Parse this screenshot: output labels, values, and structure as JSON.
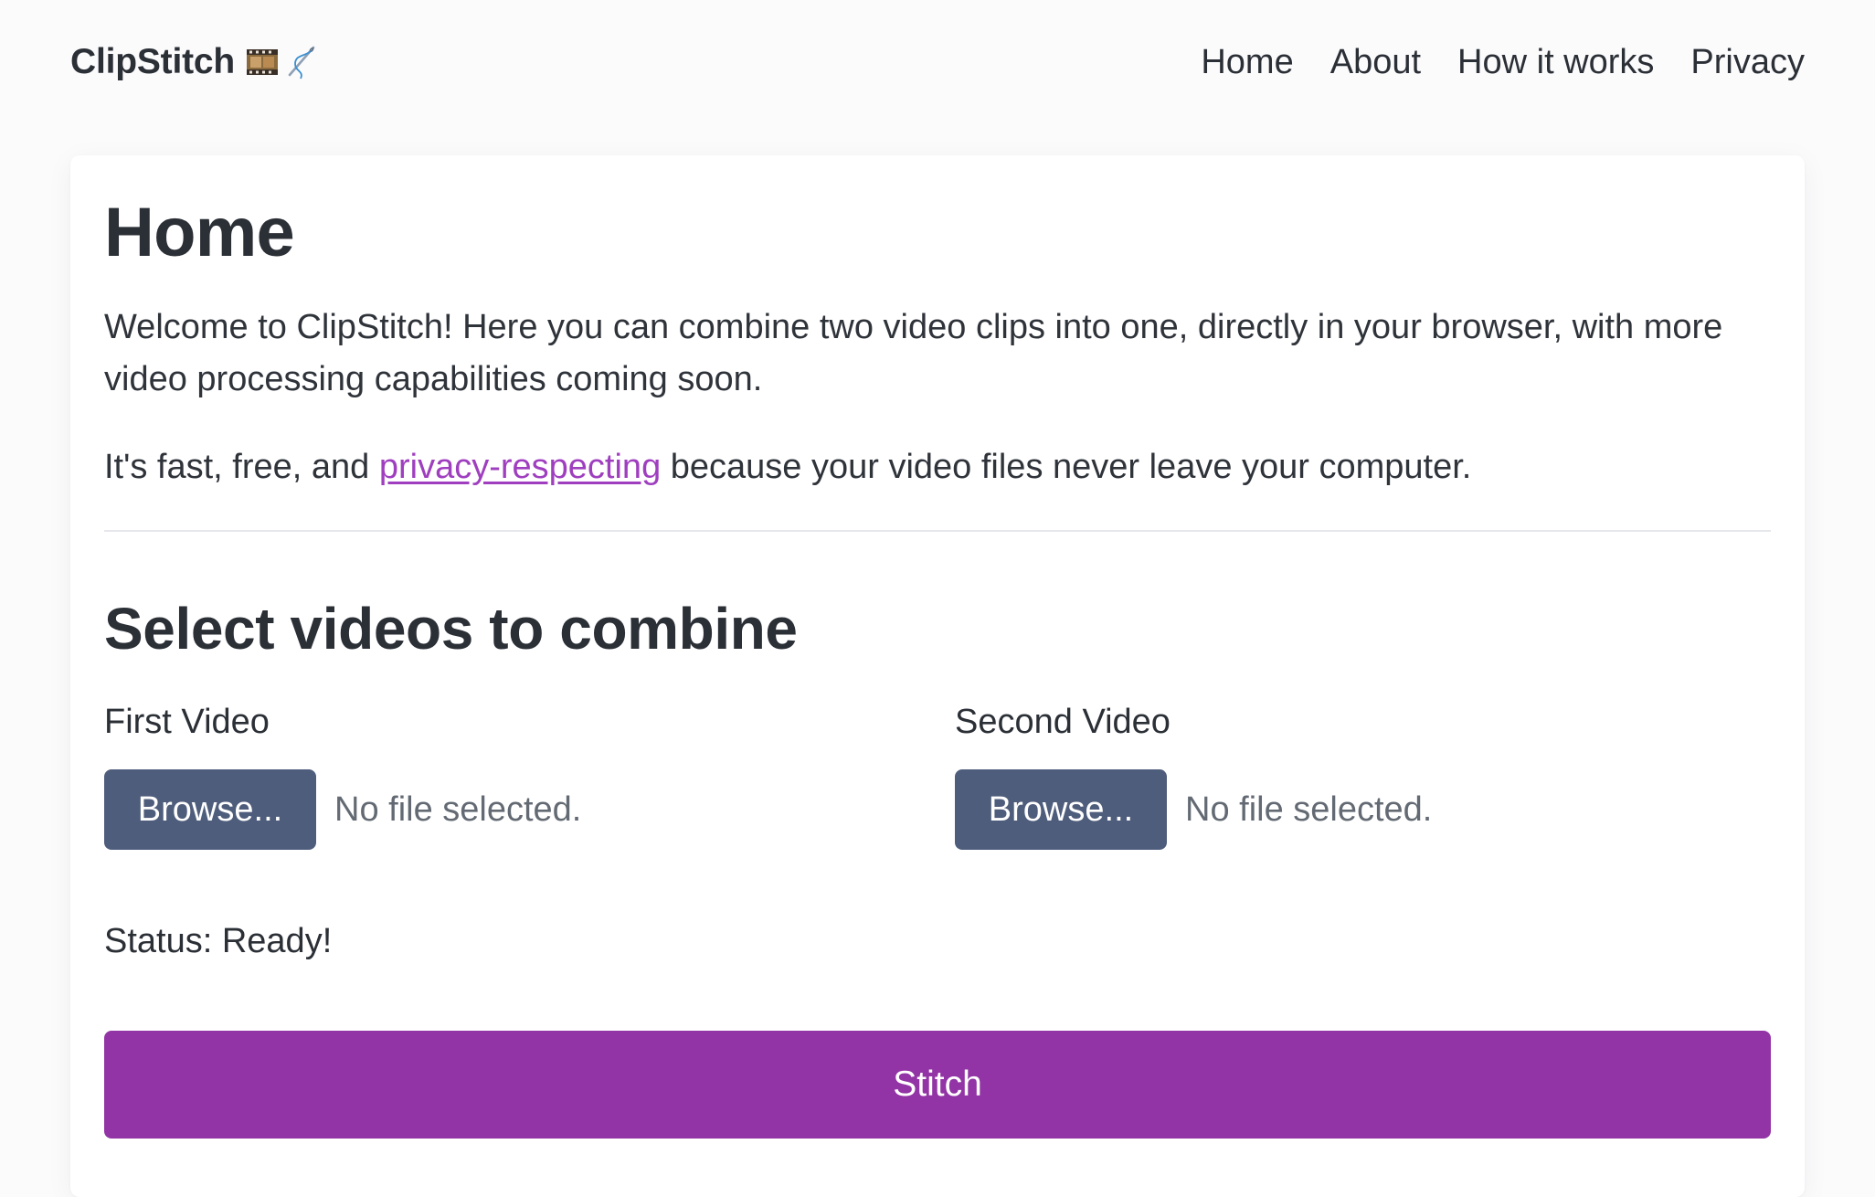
{
  "header": {
    "brand_name": "ClipStitch",
    "brand_icons": [
      "film-reel-icon",
      "needle-thread-icon"
    ],
    "nav": [
      {
        "label": "Home"
      },
      {
        "label": "About"
      },
      {
        "label": "How it works"
      },
      {
        "label": "Privacy"
      }
    ]
  },
  "main": {
    "title": "Home",
    "intro": "Welcome to ClipStitch! Here you can combine two video clips into one, directly in your browser, with more video processing capabilities coming soon.",
    "privacy_line": {
      "prefix": "It's fast, free, and ",
      "link_text": "privacy-respecting",
      "suffix": " because your video files never leave your computer."
    },
    "section_title": "Select videos to combine",
    "first_video": {
      "label": "First Video",
      "browse_label": "Browse...",
      "file_status": "No file selected."
    },
    "second_video": {
      "label": "Second Video",
      "browse_label": "Browse...",
      "file_status": "No file selected."
    },
    "status": "Status: Ready!",
    "stitch_label": "Stitch"
  },
  "colors": {
    "accent": "#9234a5",
    "link": "#9f3fbf",
    "browse_button": "#4f5d7c",
    "text": "#2b2f36",
    "page_background": "#fbfbfc",
    "card_background": "#ffffff"
  }
}
